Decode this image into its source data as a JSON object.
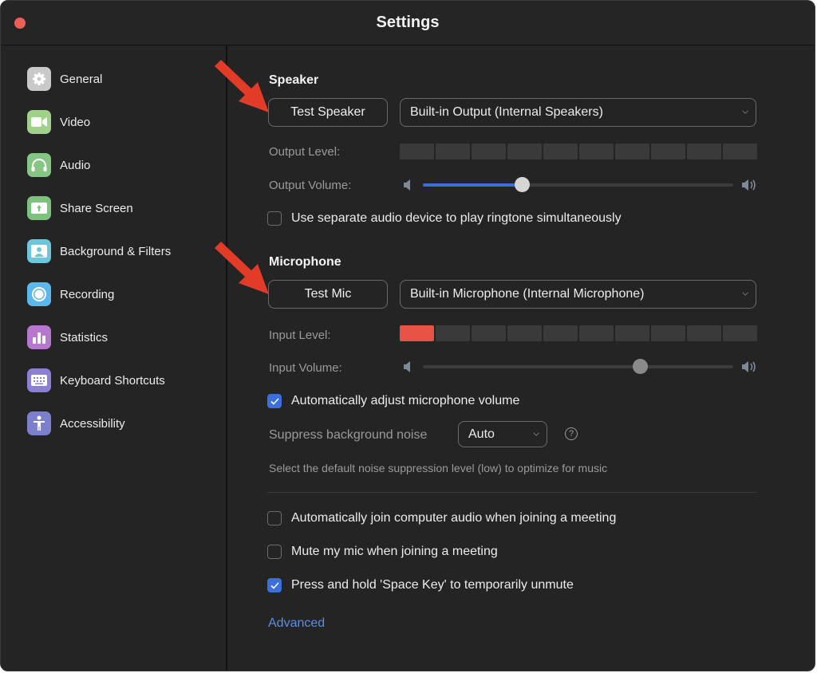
{
  "window": {
    "title": "Settings"
  },
  "colors": {
    "accent": "#3a70dc",
    "meter_active": "#e85246",
    "link": "#5c8ee6",
    "close": "#ec5f58",
    "annotation_arrow": "#e23b28"
  },
  "sidebar": {
    "items": [
      {
        "label": "General",
        "icon": "gear-icon",
        "color": "#c9c9c9"
      },
      {
        "label": "Video",
        "icon": "video-camera-icon",
        "color": "#9fd18a"
      },
      {
        "label": "Audio",
        "icon": "headphones-icon",
        "color": "#86c684"
      },
      {
        "label": "Share Screen",
        "icon": "share-screen-icon",
        "color": "#7cc27c"
      },
      {
        "label": "Background & Filters",
        "icon": "background-person-icon",
        "color": "#6ec6dc"
      },
      {
        "label": "Recording",
        "icon": "record-icon",
        "color": "#5ab8ec"
      },
      {
        "label": "Statistics",
        "icon": "bar-chart-icon",
        "color": "#b777cf"
      },
      {
        "label": "Keyboard Shortcuts",
        "icon": "keyboard-icon",
        "color": "#8a80d8"
      },
      {
        "label": "Accessibility",
        "icon": "accessibility-icon",
        "color": "#7c7fcb"
      }
    ]
  },
  "speaker": {
    "title": "Speaker",
    "test_button": "Test Speaker",
    "device": "Built-in Output (Internal Speakers)",
    "output_level_label": "Output Level:",
    "output_level": {
      "segments": 10,
      "active": 0
    },
    "output_volume_label": "Output Volume:",
    "output_volume_percent": 32,
    "separate_ringtone": {
      "label": "Use separate audio device to play ringtone simultaneously",
      "checked": false
    }
  },
  "microphone": {
    "title": "Microphone",
    "test_button": "Test Mic",
    "device": "Built-in Microphone (Internal Microphone)",
    "input_level_label": "Input Level:",
    "input_level": {
      "segments": 10,
      "active": 1
    },
    "input_volume_label": "Input Volume:",
    "input_volume_percent": 70,
    "auto_adjust": {
      "label": "Automatically adjust microphone volume",
      "checked": true
    },
    "suppress_label": "Suppress background noise",
    "suppress_value": "Auto",
    "suppress_hint": "Select the default noise suppression level (low) to optimize for music"
  },
  "options": [
    {
      "label": "Automatically join computer audio when joining a meeting",
      "checked": false
    },
    {
      "label": "Mute my mic when joining a meeting",
      "checked": false
    },
    {
      "label": "Press and hold 'Space Key' to temporarily unmute",
      "checked": true
    }
  ],
  "advanced_link": "Advanced"
}
